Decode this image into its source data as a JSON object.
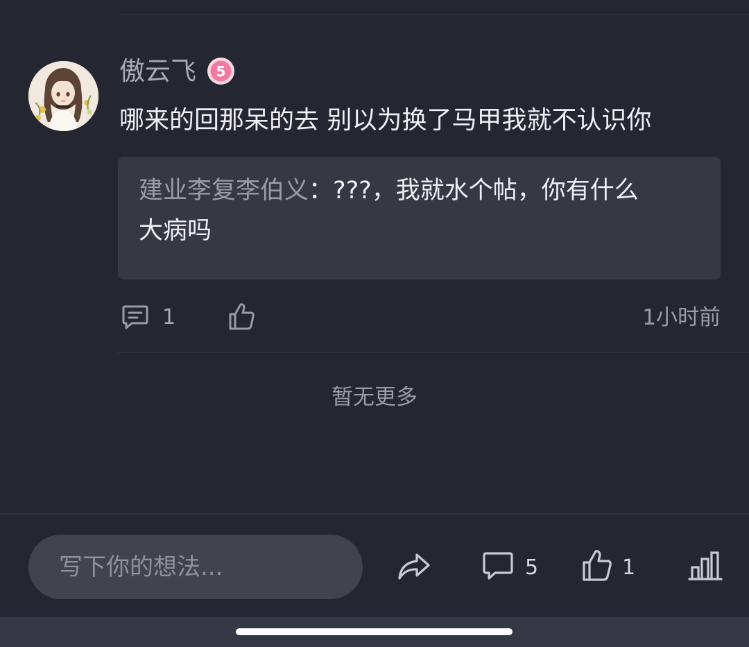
{
  "comment": {
    "username": "傲云飞",
    "level": "5",
    "text": "哪来的回那呆的去 别以为换了马甲我就不认识你",
    "reply": {
      "author": "建业李复李伯义",
      "separator": "：",
      "line1": "???，我就水个帖，你有什么",
      "line2": "大病吗"
    },
    "reply_count": "1",
    "time": "1小时前"
  },
  "list_end_text": "暂无更多",
  "bottom_bar": {
    "input_placeholder": "写下你的想法...",
    "comment_count": "5",
    "like_count": "1"
  },
  "icons": {
    "reply": "comment-bubble-icon",
    "like": "thumbs-up-icon",
    "share": "share-arrow-icon",
    "stats": "bar-chart-icon",
    "level": "level-badge-icon"
  },
  "colors": {
    "background": "#242631",
    "card": "#363844",
    "badge": "#f07aa0",
    "muted_text": "#9a9ca7"
  }
}
